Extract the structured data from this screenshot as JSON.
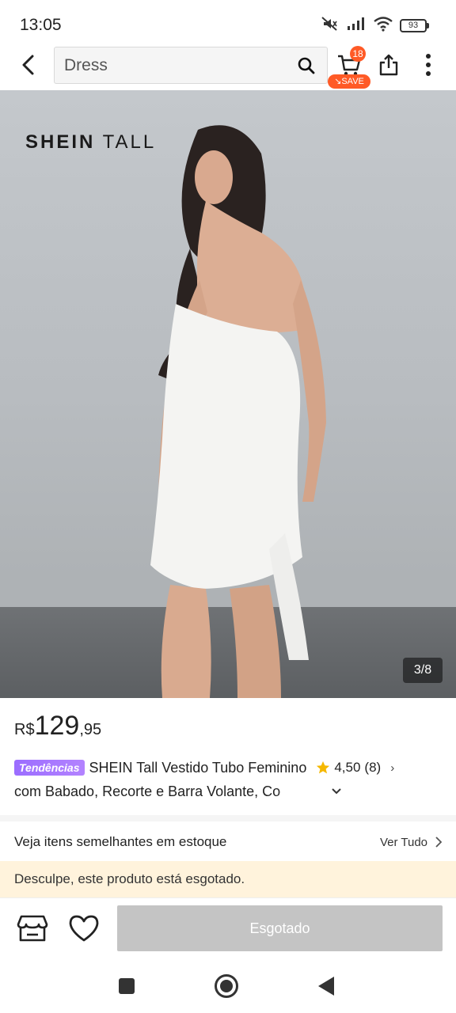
{
  "status_bar": {
    "time": "13:05",
    "battery": "93",
    "icons": [
      "mute-icon",
      "signal-icon",
      "wifi-icon",
      "battery-icon"
    ]
  },
  "top_bar": {
    "search_value": "Dress",
    "cart_count": "18",
    "cart_save_label": "SAVE",
    "icons": [
      "back-arrow-icon",
      "search-icon",
      "cart-icon",
      "share-icon",
      "more-vertical-icon"
    ]
  },
  "gallery": {
    "brand_prefix": "SHEIN",
    "brand_suffix": "TALL",
    "counter": "3/8"
  },
  "product": {
    "price_currency": "R$",
    "price_int": "129",
    "price_dec": ",95",
    "badge": "Tendências",
    "title_line1": "SHEIN Tall Vestido Tubo Feminino",
    "title_line2": "com Babado, Recorte e Barra Volante, Co",
    "rating": "4,50",
    "rating_count": "(8)"
  },
  "similar": {
    "title": "Veja itens semelhantes em estoque",
    "link": "Ver Tudo"
  },
  "notice": {
    "soldout_message": "Desculpe, este produto está esgotado."
  },
  "actions": {
    "soldout_button": "Esgotado",
    "icons": [
      "store-icon",
      "heart-icon"
    ]
  },
  "colors": {
    "accent": "#ff5a26",
    "badge_purple": "#9b6dff",
    "notice_bg": "#fff3dc",
    "disabled_button": "#c4c4c4",
    "star": "#f5b800"
  }
}
